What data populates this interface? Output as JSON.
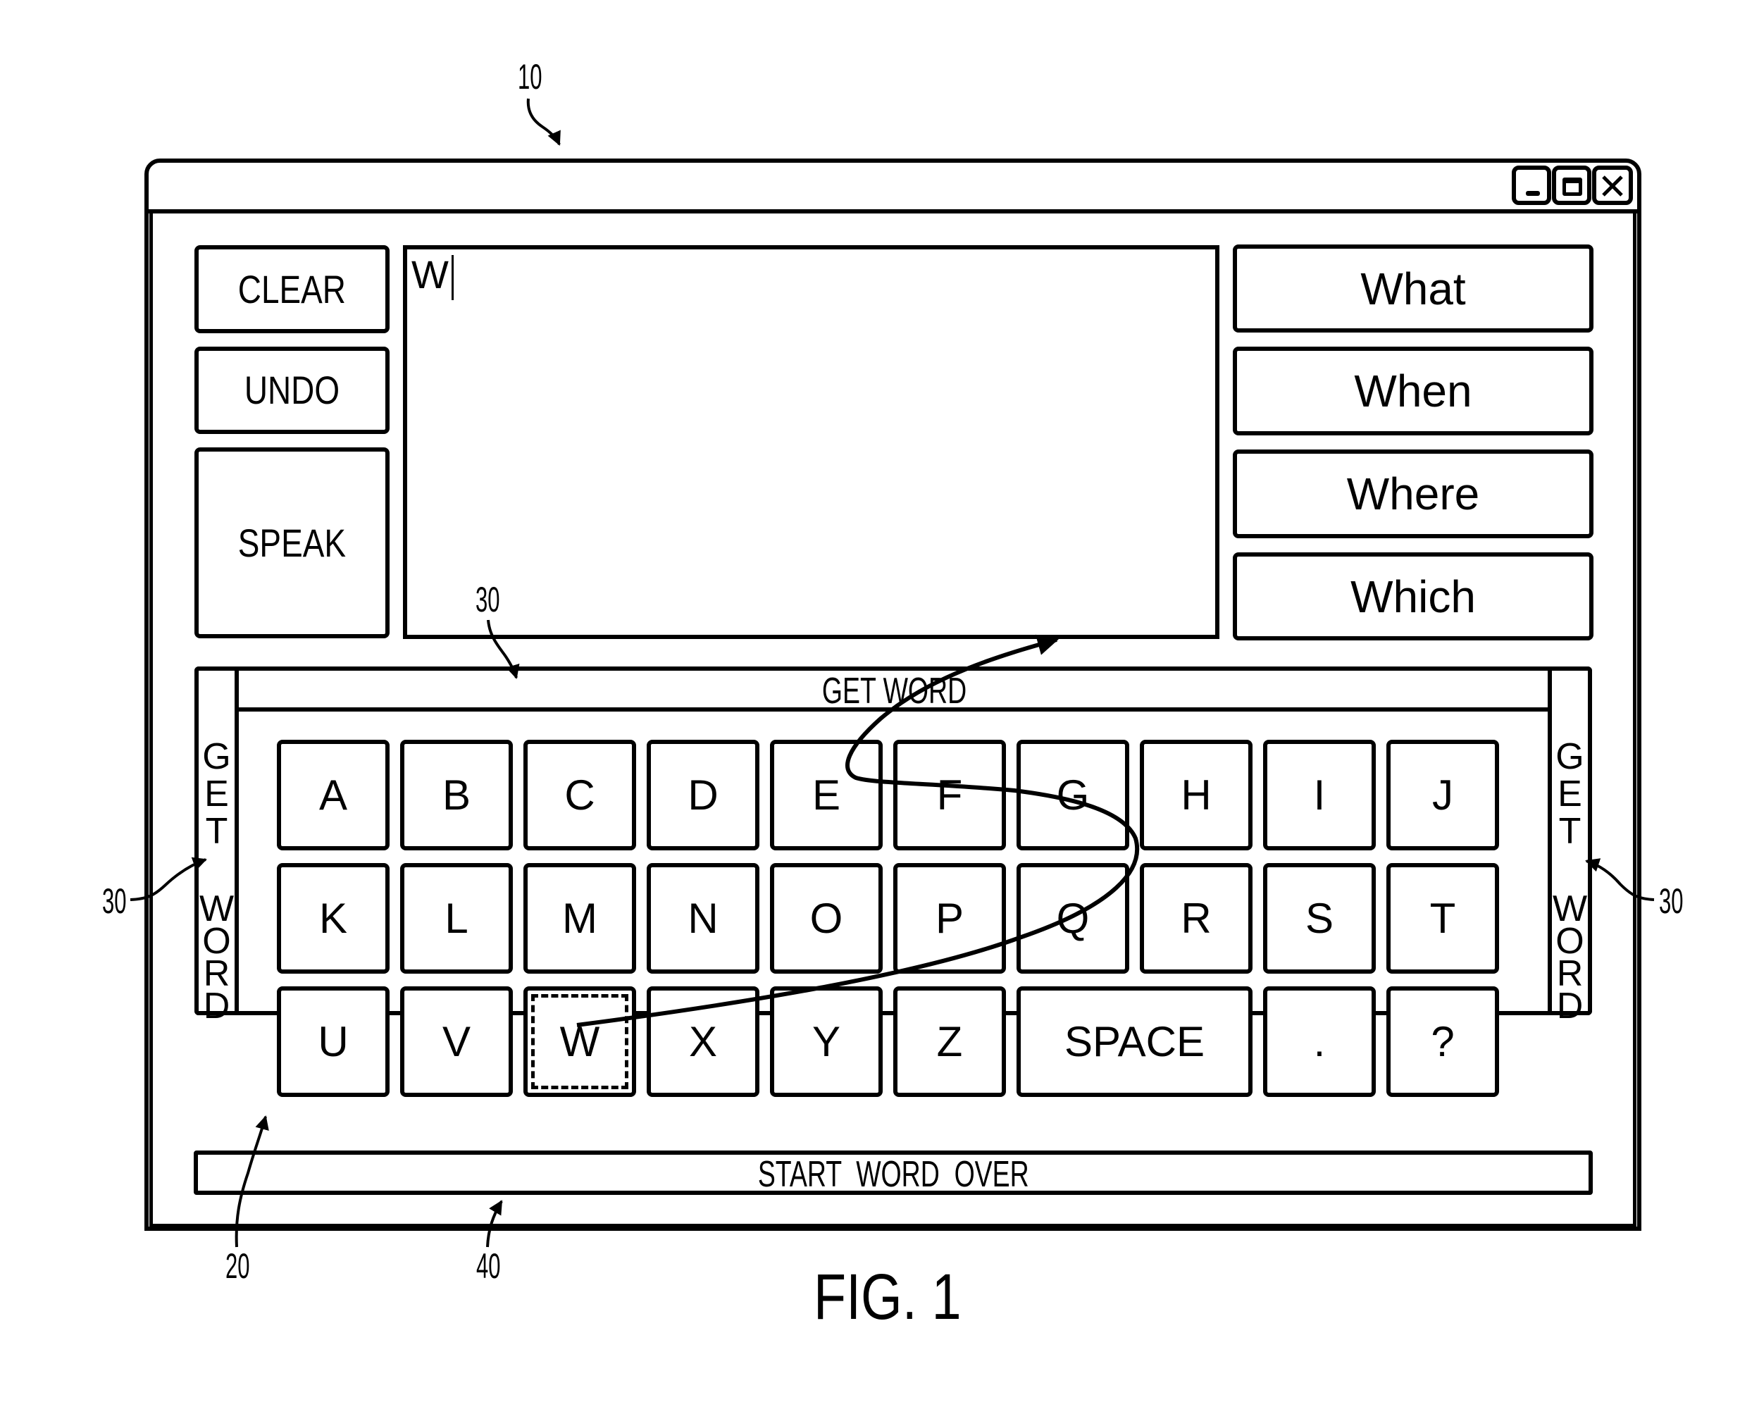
{
  "figure": {
    "caption": "FIG. 1",
    "reference_numerals": {
      "device": "10",
      "keyboard": "20",
      "get_word_top": "30",
      "get_word_left": "30",
      "get_word_right": "30",
      "start_word_over": "40"
    }
  },
  "window": {
    "controls": {
      "minimize": "minimize-icon",
      "maximize": "maximize-icon",
      "close": "close-icon"
    }
  },
  "left_buttons": {
    "clear": "CLEAR",
    "undo": "UNDO",
    "speak": "SPEAK"
  },
  "text_area": {
    "value": "W"
  },
  "word_predictions": [
    "What",
    "When",
    "Where",
    "Which"
  ],
  "get_word": {
    "top_label": "GET WORD",
    "side_letters": [
      "G",
      "E",
      "T",
      "",
      "W",
      "O",
      "R",
      "D"
    ]
  },
  "keyboard": {
    "rows": [
      [
        "A",
        "B",
        "C",
        "D",
        "E",
        "F",
        "G",
        "H",
        "I",
        "J"
      ],
      [
        "K",
        "L",
        "M",
        "N",
        "O",
        "P",
        "Q",
        "R",
        "S",
        "T"
      ],
      [
        "U",
        "V",
        "W",
        "X",
        "Y",
        "Z",
        "SPACE",
        ".",
        "?"
      ]
    ],
    "selected_key": "W"
  },
  "start_word_over": {
    "label": "START  WORD  OVER"
  }
}
